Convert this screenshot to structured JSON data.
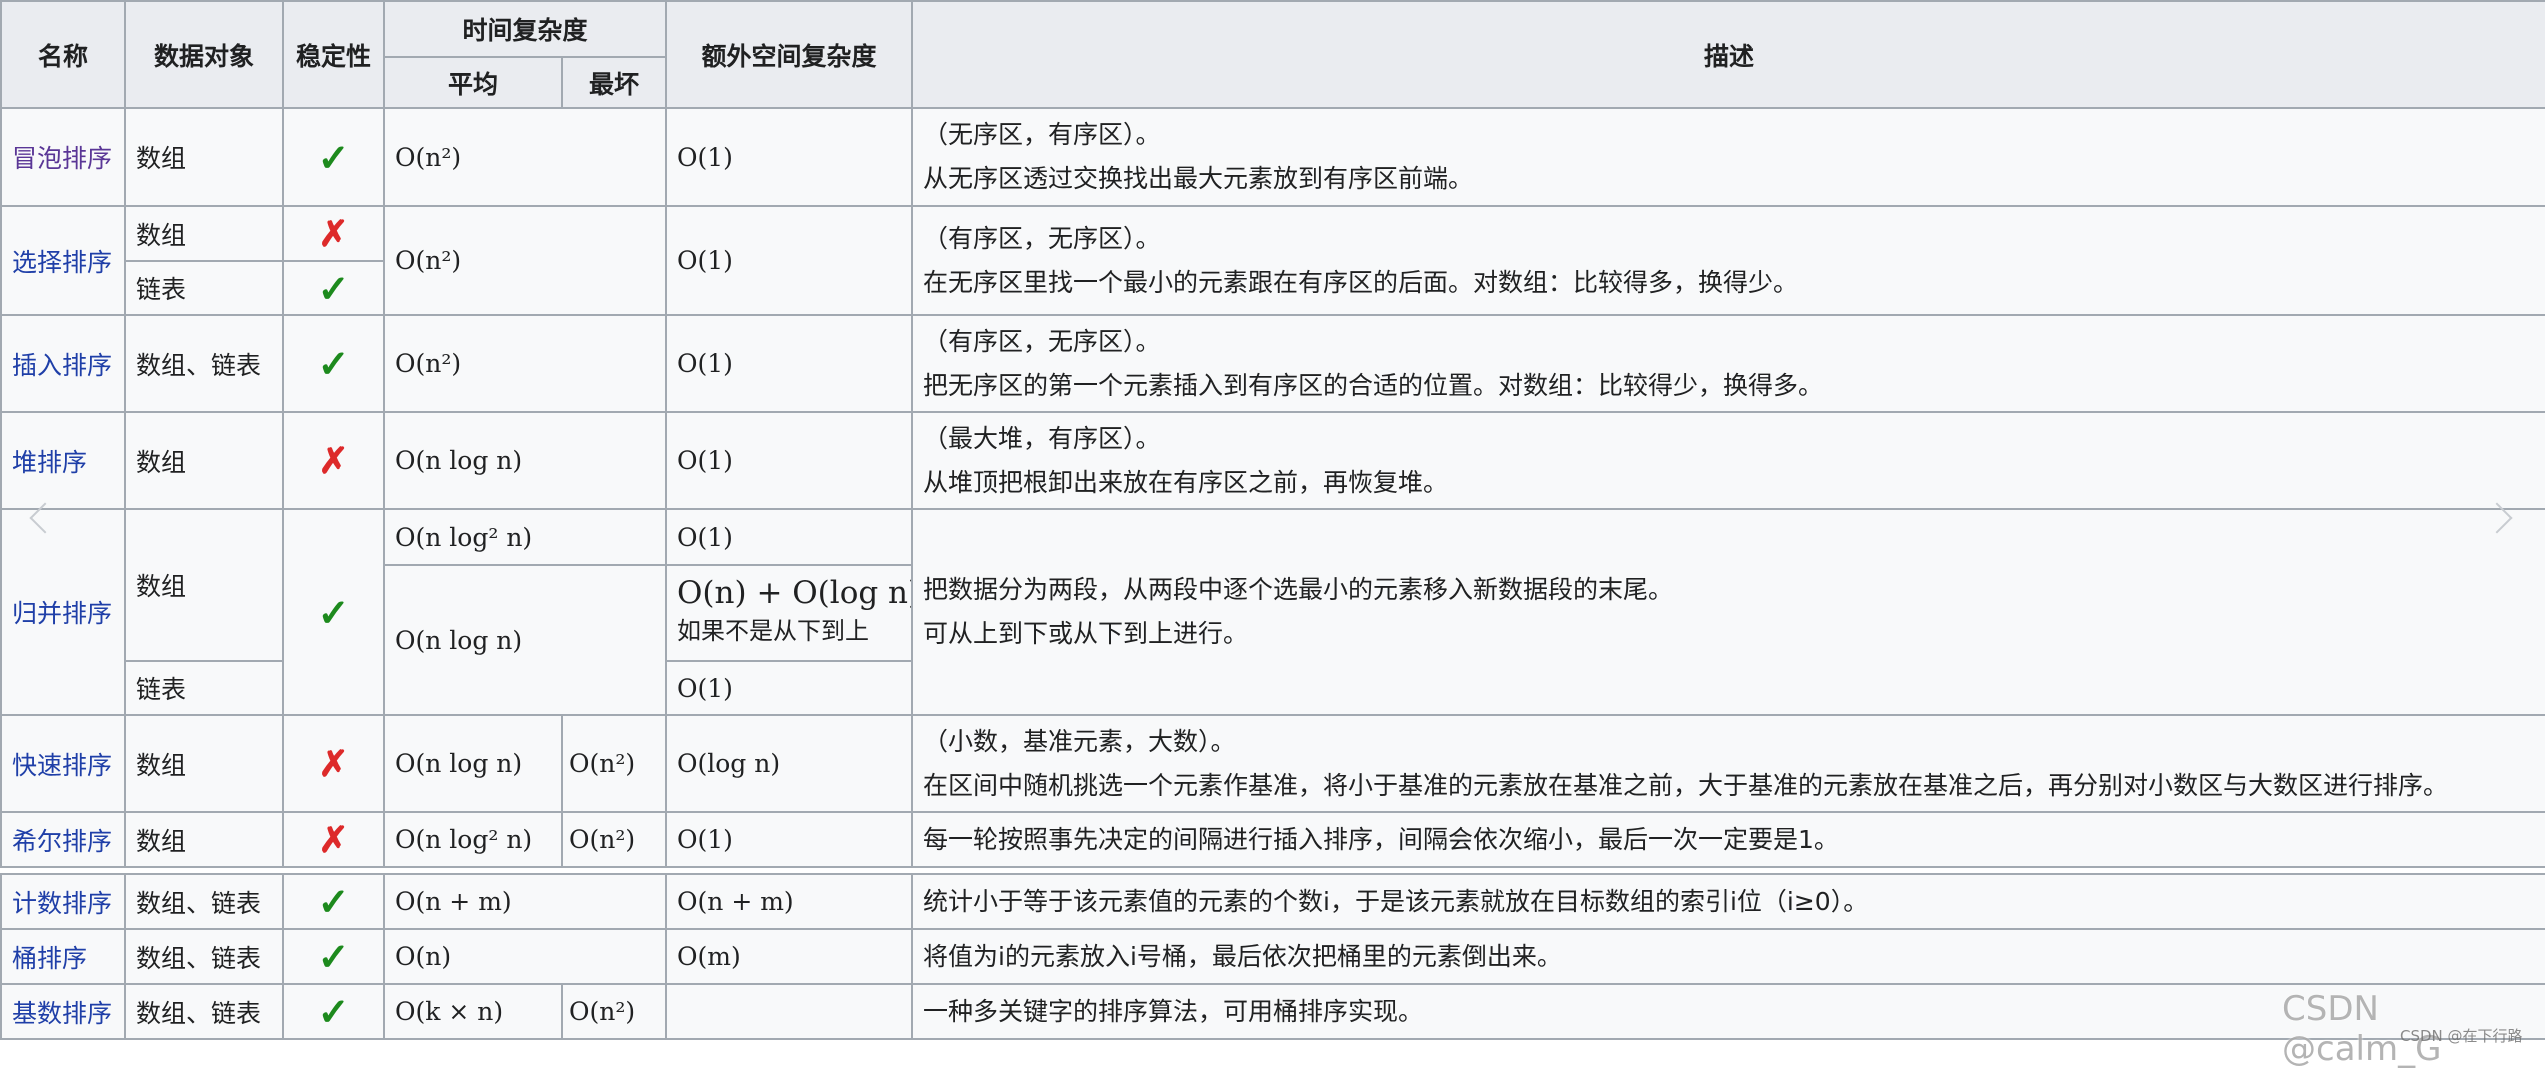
{
  "table": {
    "headers": {
      "name": "名称",
      "data_object": "数据对象",
      "stability": "稳定性",
      "time_complexity": "时间复杂度",
      "average": "平均",
      "worst": "最坏",
      "extra_space": "额外空间复杂度",
      "description": "描述"
    },
    "rows": {
      "bubble": {
        "name": "冒泡排序",
        "object": "数组",
        "stable": "✓",
        "avg": "O(n²)",
        "space": "O(1)",
        "desc1": "（无序区，有序区）。",
        "desc2": "从无序区透过交换找出最大元素放到有序区前端。"
      },
      "selection": {
        "name": "选择排序",
        "object_array": "数组",
        "stable_array": "✗",
        "object_list": "链表",
        "stable_list": "✓",
        "avg": "O(n²)",
        "space": "O(1)",
        "desc1": "（有序区，无序区）。",
        "desc2": "在无序区里找一个最小的元素跟在有序区的后面。对数组：比较得多，换得少。"
      },
      "insertion": {
        "name": "插入排序",
        "object": "数组、链表",
        "stable": "✓",
        "avg": "O(n²)",
        "space": "O(1)",
        "desc1": "（有序区，无序区）。",
        "desc2": "把无序区的第一个元素插入到有序区的合适的位置。对数组：比较得少，换得多。"
      },
      "heap": {
        "name": "堆排序",
        "object": "数组",
        "stable": "✗",
        "avg": "O(n log n)",
        "space": "O(1)",
        "desc1": "（最大堆，有序区）。",
        "desc2": "从堆顶把根卸出来放在有序区之前，再恢复堆。"
      },
      "merge": {
        "name": "归并排序",
        "object_array": "数组",
        "object_list": "链表",
        "stable": "✓",
        "avg_1": "O(n log² n)",
        "space_1": "O(1)",
        "avg_2": "O(n log n)",
        "space_2": "O(n) + O(log n)",
        "space_2_note": "如果不是从下到上",
        "space_3": "O(1)",
        "desc1": "把数据分为两段，从两段中逐个选最小的元素移入新数据段的末尾。",
        "desc2": "可从上到下或从下到上进行。"
      },
      "quick": {
        "name": "快速排序",
        "object": "数组",
        "stable": "✗",
        "avg": "O(n log n)",
        "worst": "O(n²)",
        "space": "O(log n)",
        "desc1": "（小数，基准元素，大数）。",
        "desc2": "在区间中随机挑选一个元素作基准，将小于基准的元素放在基准之前，大于基准的元素放在基准之后，再分别对小数区与大数区进行排序。"
      },
      "shell": {
        "name": "希尔排序",
        "object": "数组",
        "stable": "✗",
        "avg": "O(n log² n)",
        "worst": "O(n²)",
        "space": "O(1)",
        "desc": "每一轮按照事先决定的间隔进行插入排序，间隔会依次缩小，最后一次一定要是1。"
      },
      "counting": {
        "name": "计数排序",
        "object": "数组、链表",
        "stable": "✓",
        "avg": "O(n + m)",
        "space": "O(n + m)",
        "desc": "统计小于等于该元素值的元素的个数i，于是该元素就放在目标数组的索引i位（i≥0）。"
      },
      "bucket": {
        "name": "桶排序",
        "object": "数组、链表",
        "stable": "✓",
        "avg": "O(n)",
        "space": "O(m)",
        "desc": "将值为i的元素放入i号桶，最后依次把桶里的元素倒出来。"
      },
      "radix": {
        "name": "基数排序",
        "object": "数组、链表",
        "stable": "✓",
        "avg": "O(k × n)",
        "worst": "O(n²)",
        "space": "",
        "desc": "一种多关键字的排序算法，可用桶排序实现。"
      }
    }
  },
  "watermark": {
    "main": "CSDN @calm_G",
    "sub": "CSDN @在下行路"
  },
  "colors": {
    "link": "#1f3fa8",
    "check": "#1d8a1d",
    "cross": "#dd2a2a",
    "header_bg": "#eaecf0",
    "cell_bg": "#f8f9fa",
    "border": "#a2a9b1"
  }
}
